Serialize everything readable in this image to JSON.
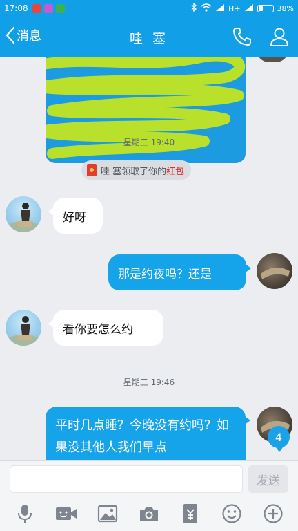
{
  "status_bar": {
    "time": "17:08",
    "network": "H+",
    "battery_level": 0.38,
    "battery": "38%"
  },
  "header": {
    "back_label": "消息",
    "title": "哇 塞",
    "icons": [
      "phone-icon",
      "profile-icon"
    ]
  },
  "messages": {
    "timestamp_1": "星期三 19:40",
    "system_notice": {
      "prefix": "哇 塞领取了你的",
      "highlight": "红包"
    },
    "msg_1": "好呀",
    "msg_2": "那是约夜吗？还是",
    "msg_3": "看你要怎么约",
    "timestamp_2": "星期三 19:46",
    "msg_4": "平时几点睡？今晚没有约吗？如果没其他人我们早点"
  },
  "unread_count": "4",
  "input": {
    "placeholder": "",
    "send_label": "发送"
  },
  "toolbar": {
    "items": [
      "microphone-icon",
      "video-icon",
      "image-icon",
      "camera-icon",
      "red-packet-icon",
      "emoji-icon",
      "plus-icon"
    ]
  },
  "colors": {
    "brand_blue": "#11a0e8",
    "bubble_blue": "#15a3ea",
    "redpacket_red": "#d9302a",
    "background": "#ebedf0"
  }
}
